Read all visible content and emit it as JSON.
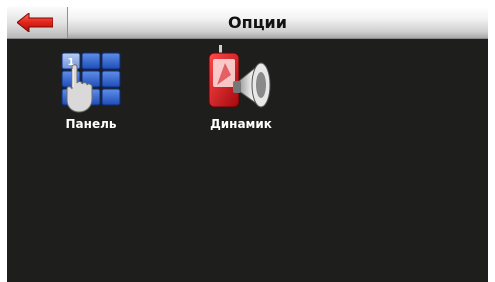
{
  "header": {
    "title": "Опции"
  },
  "options": [
    {
      "label": "Панель",
      "icon": "keypad-hand-icon"
    },
    {
      "label": "Динамик",
      "icon": "phone-speaker-icon"
    }
  ],
  "colors": {
    "screen_background": "#1e1f1c",
    "back_arrow": "#e2231a",
    "label_text": "#ffffff"
  }
}
